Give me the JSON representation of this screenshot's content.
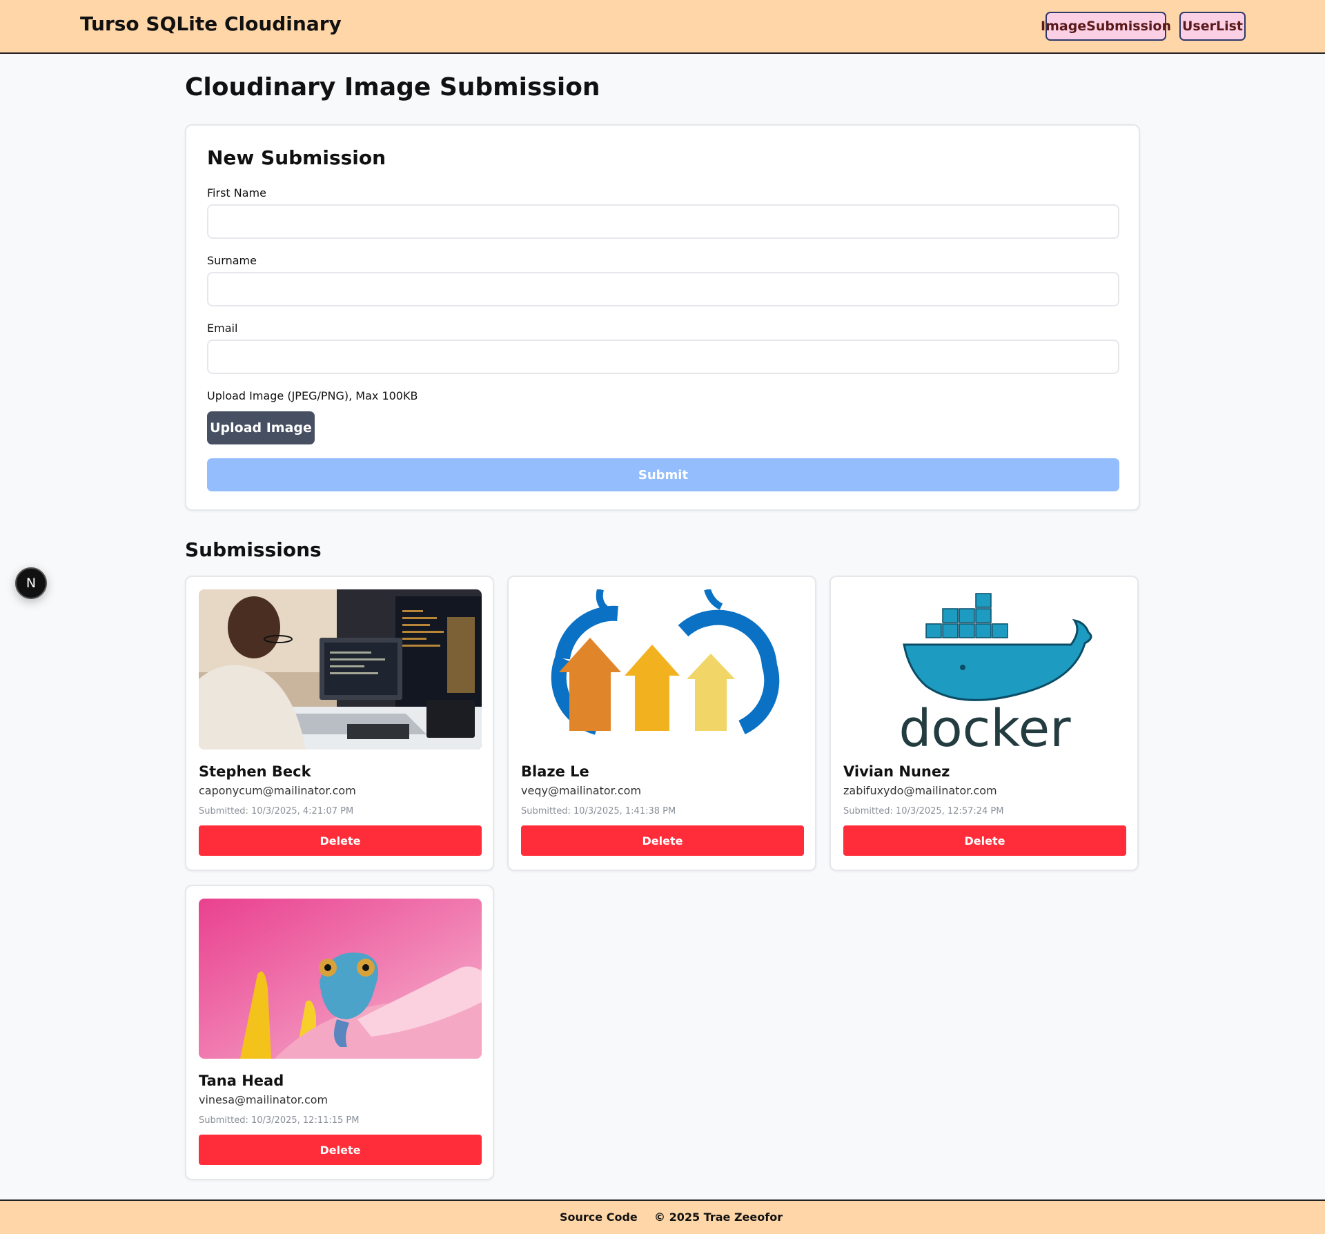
{
  "header": {
    "brand": "Turso SQLite Cloudinary",
    "nav": [
      {
        "label": "ImageSubmission"
      },
      {
        "label": "UserList"
      }
    ]
  },
  "page": {
    "title": "Cloudinary Image Submission"
  },
  "form": {
    "heading": "New Submission",
    "first_name_label": "First Name",
    "first_name_value": "",
    "surname_label": "Surname",
    "surname_value": "",
    "email_label": "Email",
    "email_value": "",
    "upload_label": "Upload Image (JPEG/PNG), Max 100KB",
    "upload_button": "Upload Image",
    "submit_button": "Submit"
  },
  "submissions": {
    "heading": "Submissions",
    "items": [
      {
        "name": "Stephen Beck",
        "email": "caponycum@mailinator.com",
        "submitted": "Submitted: 10/3/2025, 4:21:07 PM",
        "delete": "Delete",
        "image": "developer-photo"
      },
      {
        "name": "Blaze Le",
        "email": "veqy@mailinator.com",
        "submitted": "Submitted: 10/3/2025, 1:41:38 PM",
        "delete": "Delete",
        "image": "arrows-cloud-logo"
      },
      {
        "name": "Vivian Nunez",
        "email": "zabifuxydo@mailinator.com",
        "submitted": "Submitted: 10/3/2025, 12:57:24 PM",
        "delete": "Delete",
        "image": "docker-logo"
      },
      {
        "name": "Tana Head",
        "email": "vinesa@mailinator.com",
        "submitted": "Submitted: 10/3/2025, 12:11:15 PM",
        "delete": "Delete",
        "image": "chameleon-photo"
      }
    ]
  },
  "badge": {
    "letter": "N"
  },
  "footer": {
    "source_code": "Source Code",
    "copyright": "© 2025 Trae Zeeofor"
  },
  "colors": {
    "header_bg": "#ffd6a8",
    "nav_bg": "#fbcfe4",
    "upload_bg": "#475063",
    "submit_bg": "#94bdfd",
    "delete_bg": "#ff2d39"
  }
}
